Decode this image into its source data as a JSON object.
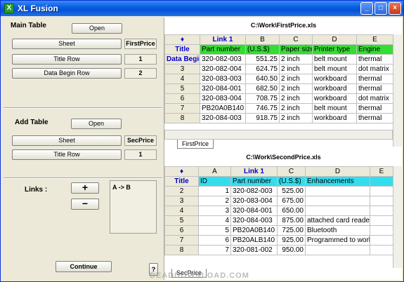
{
  "window": {
    "title": "XL Fusion",
    "app_icon": "X",
    "btn_min": "_",
    "btn_max": "□",
    "btn_close": "×"
  },
  "main_table": {
    "label": "Main Table",
    "open": "Open",
    "sheet_btn": "Sheet",
    "sheet_val": "FirstPrice",
    "title_row_btn": "Title Row",
    "title_row_val": "1",
    "data_begin_btn": "Data Begin Row",
    "data_begin_val": "2"
  },
  "add_table": {
    "label": "Add Table",
    "open": "Open",
    "sheet_btn": "Sheet",
    "sheet_val": "SecPrice",
    "title_row_btn": "Title Row",
    "title_row_val": "1"
  },
  "links": {
    "label": "Links :",
    "add": "+",
    "remove": "−",
    "mapping": "A  ->  B"
  },
  "continue_btn": "Continue",
  "help_btn": "?",
  "grid1": {
    "path": "C:\\Work\\FirstPrice.xls",
    "corner": "♦",
    "cols": [
      "Link 1",
      "B",
      "C",
      "D",
      "E"
    ],
    "rows": [
      {
        "h": "Title",
        "c": [
          "Part number",
          "(U.S.$)",
          "Paper size",
          "Printer type",
          "Engine"
        ]
      },
      {
        "h": "Data Begin",
        "c": [
          "320-082-003",
          "551.25",
          "2 inch",
          "belt mount",
          "thermal"
        ]
      },
      {
        "h": "3",
        "c": [
          "320-082-004",
          "624.75",
          "2 inch",
          "belt mount",
          "dot matrix"
        ]
      },
      {
        "h": "4",
        "c": [
          "320-083-003",
          "640.50",
          "2 inch",
          "workboard",
          "thermal"
        ]
      },
      {
        "h": "5",
        "c": [
          "320-084-001",
          "682.50",
          "2 inch",
          "workboard",
          "thermal"
        ]
      },
      {
        "h": "6",
        "c": [
          "320-083-004",
          "708.75",
          "2 inch",
          "workboard",
          "dot matrix"
        ]
      },
      {
        "h": "7",
        "c": [
          "PB20A0B140",
          "746.75",
          "2 inch",
          "belt mount",
          "thermal"
        ]
      },
      {
        "h": "8",
        "c": [
          "320-084-003",
          "918.75",
          "2 inch",
          "workboard",
          "thermal"
        ]
      }
    ],
    "tab": "FirstPrice"
  },
  "grid2": {
    "path": "C:\\Work\\SecondPrice.xls",
    "corner": "♦",
    "cols": [
      "A",
      "Link 1",
      "C",
      "D",
      "E"
    ],
    "rows": [
      {
        "h": "Title",
        "c": [
          "ID",
          "Part number",
          "(U.S.$)",
          "Enhancements",
          ""
        ]
      },
      {
        "h": "2",
        "c": [
          "1",
          "320-082-003",
          "525.00",
          "",
          ""
        ]
      },
      {
        "h": "3",
        "c": [
          "2",
          "320-083-004",
          "675.00",
          "",
          ""
        ]
      },
      {
        "h": "4",
        "c": [
          "3",
          "320-084-001",
          "650.00",
          "",
          ""
        ]
      },
      {
        "h": "5",
        "c": [
          "4",
          "320-084-003",
          "875.00",
          "attached card reader",
          ""
        ]
      },
      {
        "h": "6",
        "c": [
          "5",
          "PB20A0B140",
          "725.00",
          "Bluetooth",
          ""
        ]
      },
      {
        "h": "7",
        "c": [
          "6",
          "PB20ALB140",
          "925.00",
          "Programmed to work",
          ""
        ]
      },
      {
        "h": "8",
        "c": [
          "7",
          "320-081-002",
          "950.00",
          "",
          ""
        ]
      }
    ],
    "tab": "SecPrice"
  },
  "colors": {
    "green": "#33dd33",
    "cyan": "#33ddee",
    "link_blue": "#0000cc"
  }
}
